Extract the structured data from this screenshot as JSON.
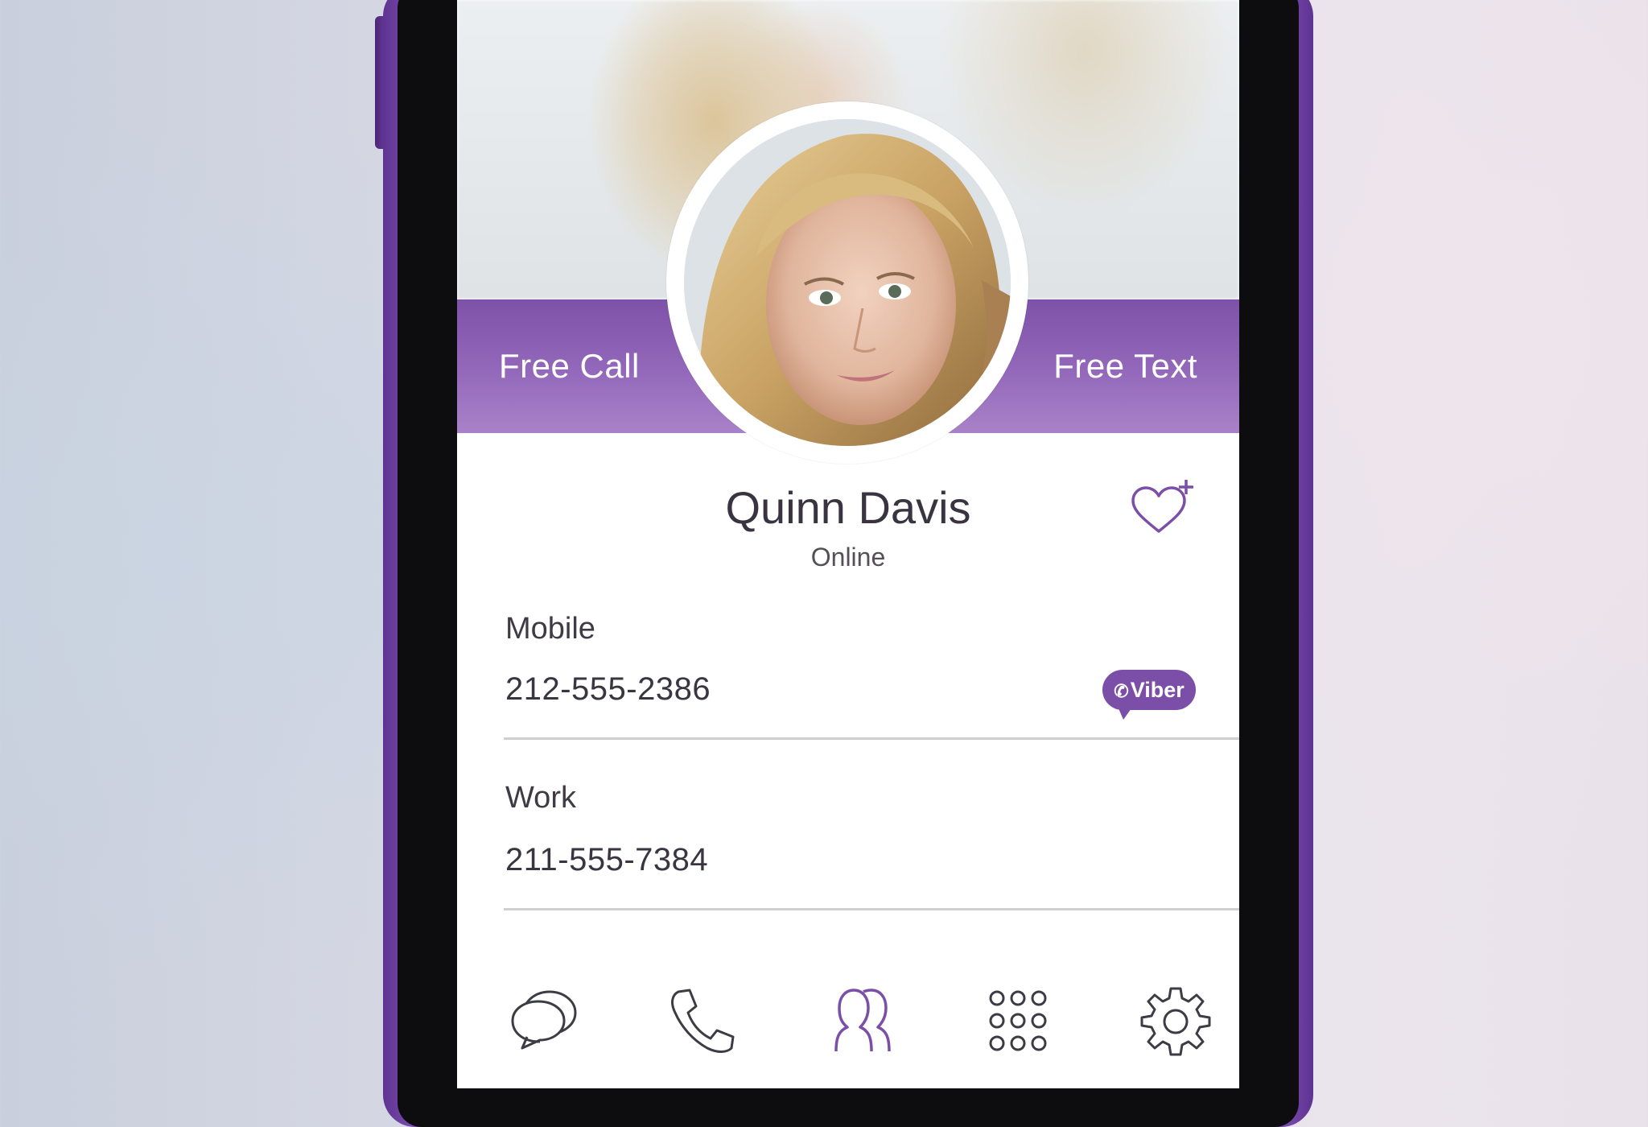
{
  "profile": {
    "name": "Quinn Davis",
    "status": "Online"
  },
  "actions": {
    "free_call_label": "Free Call",
    "free_text_label": "Free Text"
  },
  "phones": [
    {
      "label": "Mobile",
      "number": "212-555-2386",
      "badge": "Viber"
    },
    {
      "label": "Work",
      "number": "211-555-7384"
    }
  ],
  "tabbar": {
    "items": [
      {
        "icon": "chat-bubbles-icon",
        "active": false
      },
      {
        "icon": "phone-icon",
        "active": false
      },
      {
        "icon": "contacts-icon",
        "active": true
      },
      {
        "icon": "keypad-icon",
        "active": false
      },
      {
        "icon": "gear-icon",
        "active": false
      }
    ]
  },
  "colors": {
    "brand_purple": "#7b4fa7",
    "icon_gray": "#3c3c44"
  }
}
